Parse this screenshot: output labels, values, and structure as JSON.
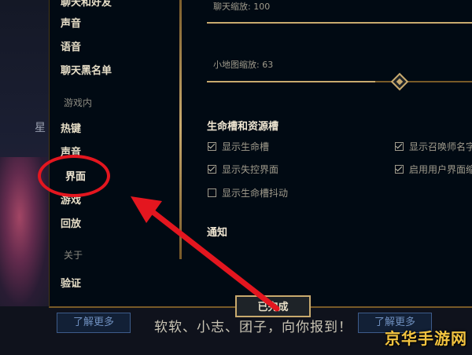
{
  "background": {
    "left_text": "星",
    "promo_buttons": [
      "了解更多",
      "了解更多"
    ],
    "promo_text": "软软、小志、团子，向你报到！"
  },
  "sidebar": {
    "items": [
      {
        "label": "聊天和好友",
        "type": "item"
      },
      {
        "label": "声音",
        "type": "item"
      },
      {
        "label": "语音",
        "type": "item"
      },
      {
        "label": "聊天黑名单",
        "type": "item"
      },
      {
        "label": "游戏内",
        "type": "header"
      },
      {
        "label": "热键",
        "type": "item"
      },
      {
        "label": "声音",
        "type": "item"
      },
      {
        "label": "界面",
        "type": "item",
        "active": true
      },
      {
        "label": "游戏",
        "type": "item"
      },
      {
        "label": "回放",
        "type": "item"
      },
      {
        "label": "关于",
        "type": "header"
      },
      {
        "label": "验证",
        "type": "item"
      }
    ]
  },
  "content": {
    "chat_scale_label": "聊天缩放: 100",
    "chat_scale_value": 100,
    "minimap_scale_label": "小地图缩放: 63",
    "minimap_scale_value": 63,
    "section_title": "生命槽和资源槽",
    "checkboxes": [
      {
        "label": "显示生命槽",
        "checked": true
      },
      {
        "label": "显示失控界面",
        "checked": true
      },
      {
        "label": "显示生命槽抖动",
        "checked": false
      },
      {
        "label": "显示召唤师名字",
        "checked": true
      },
      {
        "label": "启用用户界面缩放",
        "checked": true
      }
    ],
    "notice_title": "通知"
  },
  "footer": {
    "done_label": "已完成"
  },
  "annotation": {
    "color": "#e4161f"
  },
  "watermark": "京华手游网"
}
